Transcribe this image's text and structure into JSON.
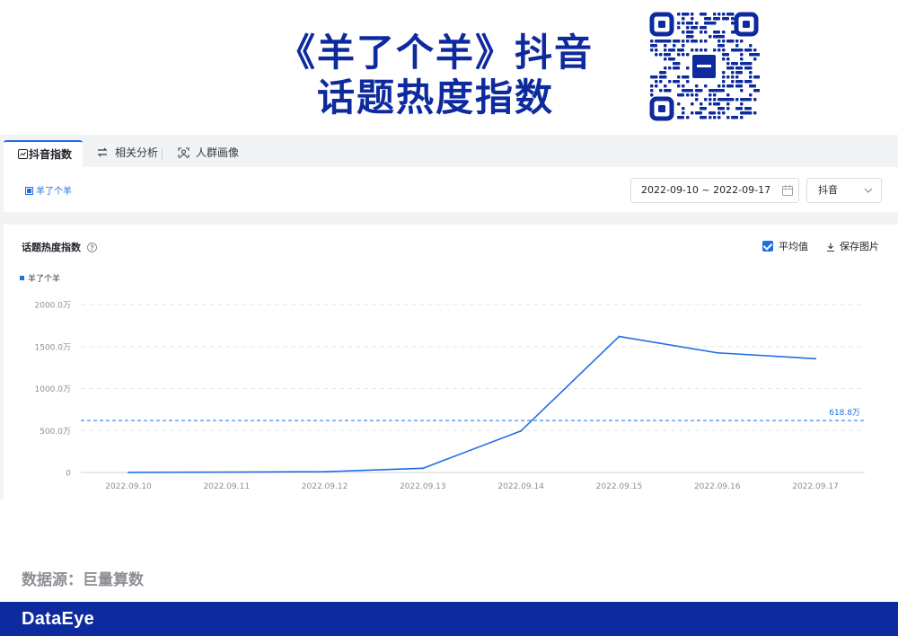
{
  "headline": {
    "line1": "《羊了个羊》抖音",
    "line2": "话题热度指数"
  },
  "tabs": [
    {
      "label": "抖音指数",
      "icon": "trend-chart-icon"
    },
    {
      "label": "相关分析",
      "icon": "relation-icon"
    },
    {
      "label": "人群画像",
      "icon": "user-portrait-icon"
    }
  ],
  "filter": {
    "topic": "羊了个羊",
    "date_range": "2022-09-10 ~ 2022-09-17",
    "platform": "抖音"
  },
  "chart_card": {
    "title": "话题热度指数",
    "average_label": "平均值",
    "save_label": "保存图片"
  },
  "chart_data": {
    "type": "line",
    "ytick_labels": [
      "0",
      "500.0万",
      "1000.0万",
      "1500.0万",
      "2000.0万"
    ],
    "yticks": [
      0,
      500,
      1000,
      1500,
      2000
    ],
    "ylim": [
      0,
      2000
    ],
    "x": [
      "2022.09.10",
      "2022.09.11",
      "2022.09.12",
      "2022.09.13",
      "2022.09.14",
      "2022.09.15",
      "2022.09.16",
      "2022.09.17"
    ],
    "series": [
      {
        "name": "羊了个羊",
        "color": "#1f6fe5",
        "values": [
          2,
          5,
          10,
          50,
          495,
          1620,
          1425,
          1355
        ]
      }
    ],
    "average": {
      "value": 618.8,
      "label": "618.8万"
    },
    "grid": true,
    "legend": "top-left"
  },
  "source": "数据源：巨量算数",
  "brand": "DataEye",
  "colors": {
    "brand_blue": "#0d2a9e",
    "accent": "#1f6fe5"
  }
}
